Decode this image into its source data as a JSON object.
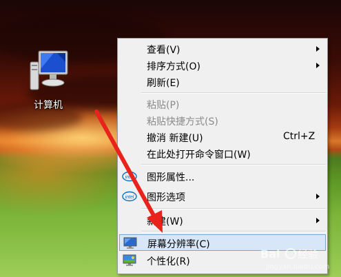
{
  "desktop": {
    "icon": {
      "label": "计算机",
      "icon_name": "computer-monitor-icon"
    }
  },
  "context_menu": {
    "items": [
      {
        "label": "查看(V)",
        "submenu": true
      },
      {
        "label": "排序方式(O)",
        "submenu": true
      },
      {
        "label": "刷新(E)"
      },
      {
        "label": "粘贴(P)",
        "disabled": true
      },
      {
        "label": "粘贴快捷方式(S)",
        "disabled": true
      },
      {
        "label": "撤消 新建(U)",
        "shortcut": "Ctrl+Z"
      },
      {
        "label": "在此处打开命令窗口(W)"
      },
      {
        "label": "图形属性...",
        "icon": "intel-icon"
      },
      {
        "label": "图形选项",
        "icon": "intel-icon",
        "submenu": true
      },
      {
        "label": "新建(W)",
        "submenu": true
      },
      {
        "label": "屏幕分辨率(C)",
        "icon": "screen-resolution-icon",
        "highlighted": true
      },
      {
        "label": "个性化(R)",
        "icon": "personalize-icon"
      }
    ]
  },
  "annotation": {
    "arrow_color": "#e8231c"
  },
  "colors": {
    "menu_bg": "#f0f0f0",
    "highlight_bg": "#d7e7f7",
    "highlight_border": "#7da2ce"
  }
}
